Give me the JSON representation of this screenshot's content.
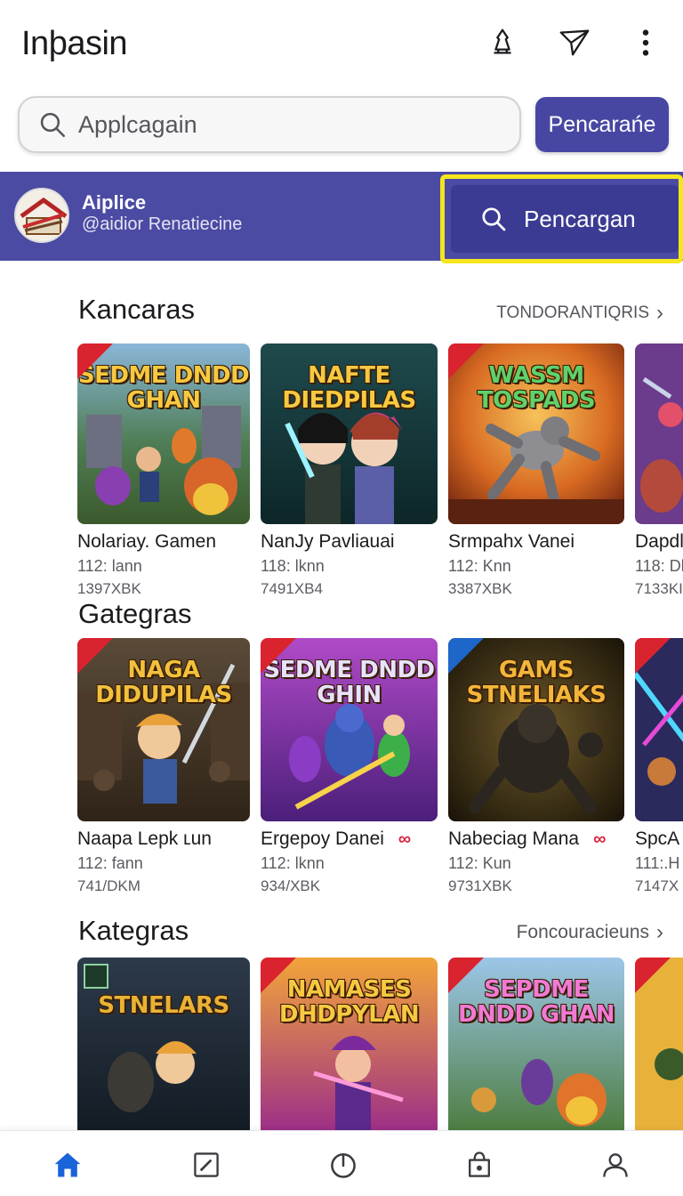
{
  "header": {
    "title": "Inþasin",
    "icons": [
      "notification-icon",
      "send-icon",
      "more-vert-icon"
    ]
  },
  "search": {
    "placeholder": "Applcagain",
    "button_label": "Pencarańe"
  },
  "banner": {
    "title": "Aiplice",
    "subtitle": "@aidior Renatiecine",
    "search_label": "Pencargan"
  },
  "sections": [
    {
      "title": "Kancaras",
      "link": "TONDORANTIQRIS",
      "items": [
        {
          "name": "Nolariay. Gamen",
          "meta": "112: lann",
          "size": "1397XBK",
          "art": "SEDME DNDD GHAN"
        },
        {
          "name": "NanJy Pavliauai",
          "meta": "118: lknn",
          "size": "7491XB4",
          "art": "NAFTE DIEDPILAS"
        },
        {
          "name": "Srmpahx Vanei",
          "meta": "112: Knn",
          "size": "3387XBK",
          "art": "WASSM TOSPADS"
        },
        {
          "name": "Dapdl",
          "meta": "118: Dl",
          "size": "7133KI",
          "art": ""
        }
      ]
    },
    {
      "title": "Gategras",
      "link": "",
      "items": [
        {
          "name": "Naapa Lepk ʟun",
          "meta": "112: fann",
          "size": "741/DKM",
          "art": "NAGA DIDUPILAS"
        },
        {
          "name": "Ergepoy Danei",
          "meta": "112: lknn",
          "size": "934/XBK",
          "art": "SEDME DNDD GHIN",
          "badge": "∞"
        },
        {
          "name": "Nabeciag Mana",
          "meta": "112: Kun",
          "size": "9731XBK",
          "art": "GAMS STNELIAKS",
          "badge": "∞"
        },
        {
          "name": "SpcA",
          "meta": "111:.H",
          "size": "7147X",
          "art": ""
        }
      ]
    },
    {
      "title": "Kategras",
      "link": "Foncouracieuns",
      "items": [
        {
          "name": "",
          "meta": "",
          "size": "",
          "art": "STNELARS"
        },
        {
          "name": "",
          "meta": "",
          "size": "",
          "art": "NAMASES DHDPYLAN"
        },
        {
          "name": "",
          "meta": "",
          "size": "",
          "art": "SEPDME DNDD GHAN"
        },
        {
          "name": "",
          "meta": "",
          "size": "",
          "art": ""
        }
      ]
    }
  ],
  "bottom_nav": [
    "home-icon",
    "edit-icon",
    "power-icon",
    "bag-icon",
    "profile-icon"
  ],
  "colors": {
    "accent": "#4747a3",
    "banner": "#4b4ba4",
    "highlight": "#f4e61d",
    "badge": "#d9233c"
  }
}
